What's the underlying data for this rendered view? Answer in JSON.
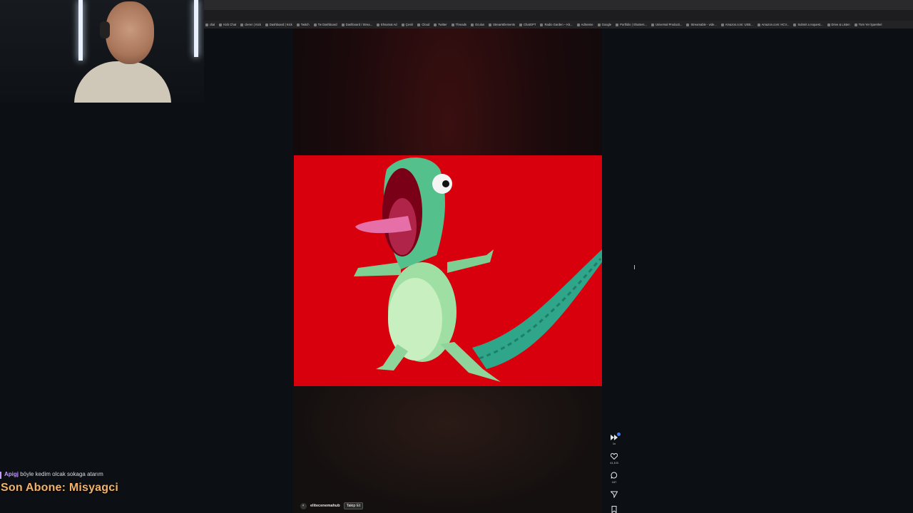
{
  "browser": {
    "bookmarks": [
      "clial",
      "Kick Chat",
      "cleren | Kick",
      "Dashboard | Kick",
      "Twitch",
      "Tw Dashboard",
      "Dashboard / Strea...",
      "Ehsamat Ad",
      "Çeviri",
      "Cloud",
      "Twitter",
      "Threads",
      "Oculus",
      "StreamElements",
      "ChatGPT",
      "Radio Garden – Kit...",
      "AdSense",
      "Google",
      "Portfolio | Shutters...",
      "Universal Producti...",
      "Streamable - vide...",
      "Amazon.com: USB...",
      "Amazon.com: HCV...",
      "Submit a request...",
      "Drive & Listen",
      "Tüm Yer İşaretleri"
    ]
  },
  "feed": {
    "author_name": "elitecenemahub",
    "follow_label": "Takip Et",
    "speed_label": "1x",
    "likes_count": "41,5 B",
    "comments_count": "167"
  },
  "overlay": {
    "chat_user": "Apigj",
    "chat_message": "böyle kedim olcak sokaga atarım",
    "last_subscriber": "Son Abone: Misyagci"
  },
  "colors": {
    "video_background": "#d9000e",
    "subscriber_text": "#f3b26a",
    "chat_user": "#c39bff"
  }
}
